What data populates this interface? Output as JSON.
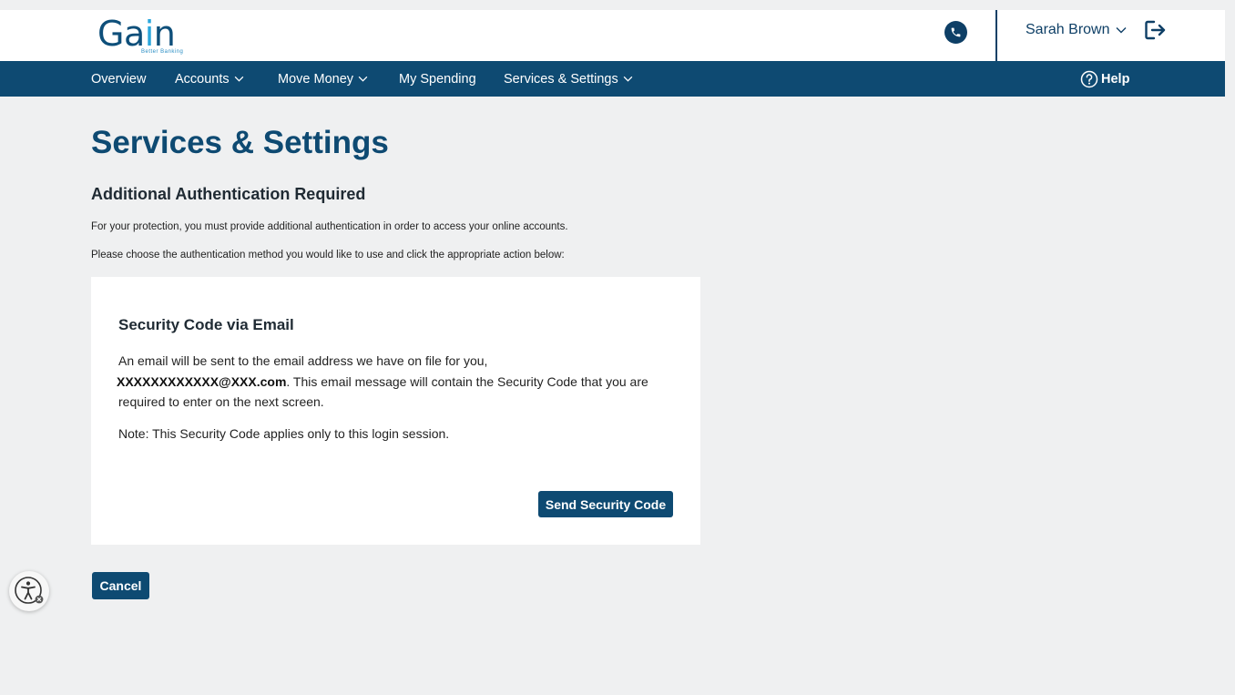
{
  "header": {
    "logo": {
      "text_g": "Ga",
      "text_i": "i",
      "text_n": "n",
      "tagline": "Better Banking"
    },
    "user_name": "Sarah Brown",
    "icons": {
      "phone": "phone-icon",
      "user_menu": "chevron-down-icon",
      "logout": "logout-icon"
    }
  },
  "nav": {
    "items": [
      {
        "label": "Overview",
        "has_dropdown": false
      },
      {
        "label": "Accounts",
        "has_dropdown": true
      },
      {
        "label": "Move Money",
        "has_dropdown": true
      },
      {
        "label": "My Spending",
        "has_dropdown": false
      },
      {
        "label": "Services & Settings",
        "has_dropdown": true
      }
    ],
    "help_label": "Help"
  },
  "main": {
    "page_title": "Services & Settings",
    "section_title": "Additional Authentication Required",
    "para1": "For your protection, you must provide additional authentication in order to access your online accounts.",
    "para2": "Please choose the authentication method you would like to use and click the appropriate action below:"
  },
  "card": {
    "title": "Security Code via Email",
    "body_pre": "An email will be sent to the email address we have on file for you,",
    "email": "XXXXXXXXXXXX@XXX.com",
    "body_post": ". This email message will contain the Security Code that you are required to enter on the next screen.",
    "note": "Note: This Security Code applies only to this login session.",
    "send_button": "Send Security Code"
  },
  "cancel_button": "Cancel",
  "accessibility_icon": "accessibility-icon",
  "colors": {
    "brand_navy": "#0e4a72",
    "page_background": "#eff0f1",
    "logo_accent": "#2aa7dc"
  }
}
